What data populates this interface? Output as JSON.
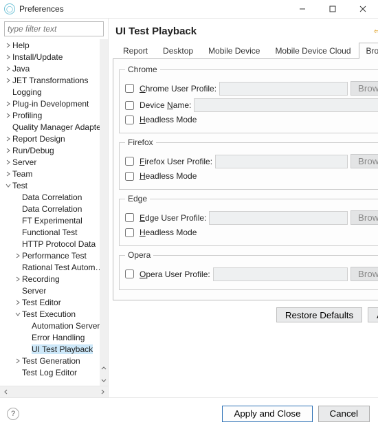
{
  "window": {
    "title": "Preferences"
  },
  "sidebar": {
    "filter_placeholder": "type filter text",
    "items": [
      {
        "label": "Help",
        "depth": 0,
        "expander": "closed"
      },
      {
        "label": "Install/Update",
        "depth": 0,
        "expander": "closed"
      },
      {
        "label": "Java",
        "depth": 0,
        "expander": "closed"
      },
      {
        "label": "JET Transformations",
        "depth": 0,
        "expander": "closed"
      },
      {
        "label": "Logging",
        "depth": 0,
        "expander": "none"
      },
      {
        "label": "Plug-in Development",
        "depth": 0,
        "expander": "closed"
      },
      {
        "label": "Profiling",
        "depth": 0,
        "expander": "closed"
      },
      {
        "label": "Quality Manager Adapter",
        "depth": 0,
        "expander": "none"
      },
      {
        "label": "Report Design",
        "depth": 0,
        "expander": "closed"
      },
      {
        "label": "Run/Debug",
        "depth": 0,
        "expander": "closed"
      },
      {
        "label": "Server",
        "depth": 0,
        "expander": "closed"
      },
      {
        "label": "Team",
        "depth": 0,
        "expander": "closed"
      },
      {
        "label": "Test",
        "depth": 0,
        "expander": "open"
      },
      {
        "label": "Data Correlation",
        "depth": 1,
        "expander": "none"
      },
      {
        "label": "Data Correlation",
        "depth": 1,
        "expander": "none"
      },
      {
        "label": "FT Experimental",
        "depth": 1,
        "expander": "none"
      },
      {
        "label": "Functional Test",
        "depth": 1,
        "expander": "none"
      },
      {
        "label": "HTTP Protocol Data",
        "depth": 1,
        "expander": "none"
      },
      {
        "label": "Performance Test",
        "depth": 1,
        "expander": "closed"
      },
      {
        "label": "Rational Test Automation",
        "depth": 1,
        "expander": "none"
      },
      {
        "label": "Recording",
        "depth": 1,
        "expander": "closed"
      },
      {
        "label": "Server",
        "depth": 1,
        "expander": "none"
      },
      {
        "label": "Test Editor",
        "depth": 1,
        "expander": "closed"
      },
      {
        "label": "Test Execution",
        "depth": 1,
        "expander": "open"
      },
      {
        "label": "Automation Server",
        "depth": 2,
        "expander": "none"
      },
      {
        "label": "Error Handling",
        "depth": 2,
        "expander": "none"
      },
      {
        "label": "UI Test Playback",
        "depth": 2,
        "expander": "none",
        "selected": true
      },
      {
        "label": "Test Generation",
        "depth": 1,
        "expander": "closed"
      },
      {
        "label": "Test Log Editor",
        "depth": 1,
        "expander": "none"
      }
    ]
  },
  "main": {
    "title": "UI Test Playback",
    "tabs": [
      {
        "label": "Report",
        "active": false
      },
      {
        "label": "Desktop",
        "active": false
      },
      {
        "label": "Mobile Device",
        "active": false
      },
      {
        "label": "Mobile Device Cloud",
        "active": false
      },
      {
        "label": "Browser",
        "active": true
      }
    ],
    "browser_tab": {
      "groups": [
        {
          "name": "Chrome",
          "rows": [
            {
              "key": "chrome_profile",
              "label_pre": "",
              "label_u": "C",
              "label_post": "hrome User Profile:",
              "has_input": true,
              "has_browse": true,
              "browse_label": "Browse"
            },
            {
              "key": "chrome_device",
              "label_pre": "Device ",
              "label_u": "N",
              "label_post": "ame:",
              "has_input": true,
              "has_browse": false
            },
            {
              "key": "chrome_headless",
              "label_pre": "",
              "label_u": "H",
              "label_post": "eadless Mode",
              "has_input": false,
              "has_browse": false
            }
          ]
        },
        {
          "name": "Firefox",
          "rows": [
            {
              "key": "ff_profile",
              "label_pre": "",
              "label_u": "F",
              "label_post": "irefox User Profile:",
              "has_input": true,
              "has_browse": true,
              "browse_label": "Browse"
            },
            {
              "key": "ff_headless",
              "label_pre": "",
              "label_u": "H",
              "label_post": "eadless Mode",
              "has_input": false,
              "has_browse": false
            }
          ]
        },
        {
          "name": "Edge",
          "rows": [
            {
              "key": "edge_profile",
              "label_pre": "",
              "label_u": "E",
              "label_post": "dge User Profile:",
              "has_input": true,
              "has_browse": true,
              "browse_label": "Browse"
            },
            {
              "key": "edge_headless",
              "label_pre": "",
              "label_u": "H",
              "label_post": "eadless Mode",
              "has_input": false,
              "has_browse": false
            }
          ]
        },
        {
          "name": "Opera",
          "rows": [
            {
              "key": "opera_profile",
              "label_pre": "",
              "label_u": "O",
              "label_post": "pera User Profile:",
              "has_input": true,
              "has_browse": true,
              "browse_label": "Browse"
            }
          ]
        }
      ]
    },
    "restore_label": "Restore Defaults",
    "apply_label": "Apply"
  },
  "footer": {
    "apply_close": "Apply and Close",
    "cancel": "Cancel"
  }
}
